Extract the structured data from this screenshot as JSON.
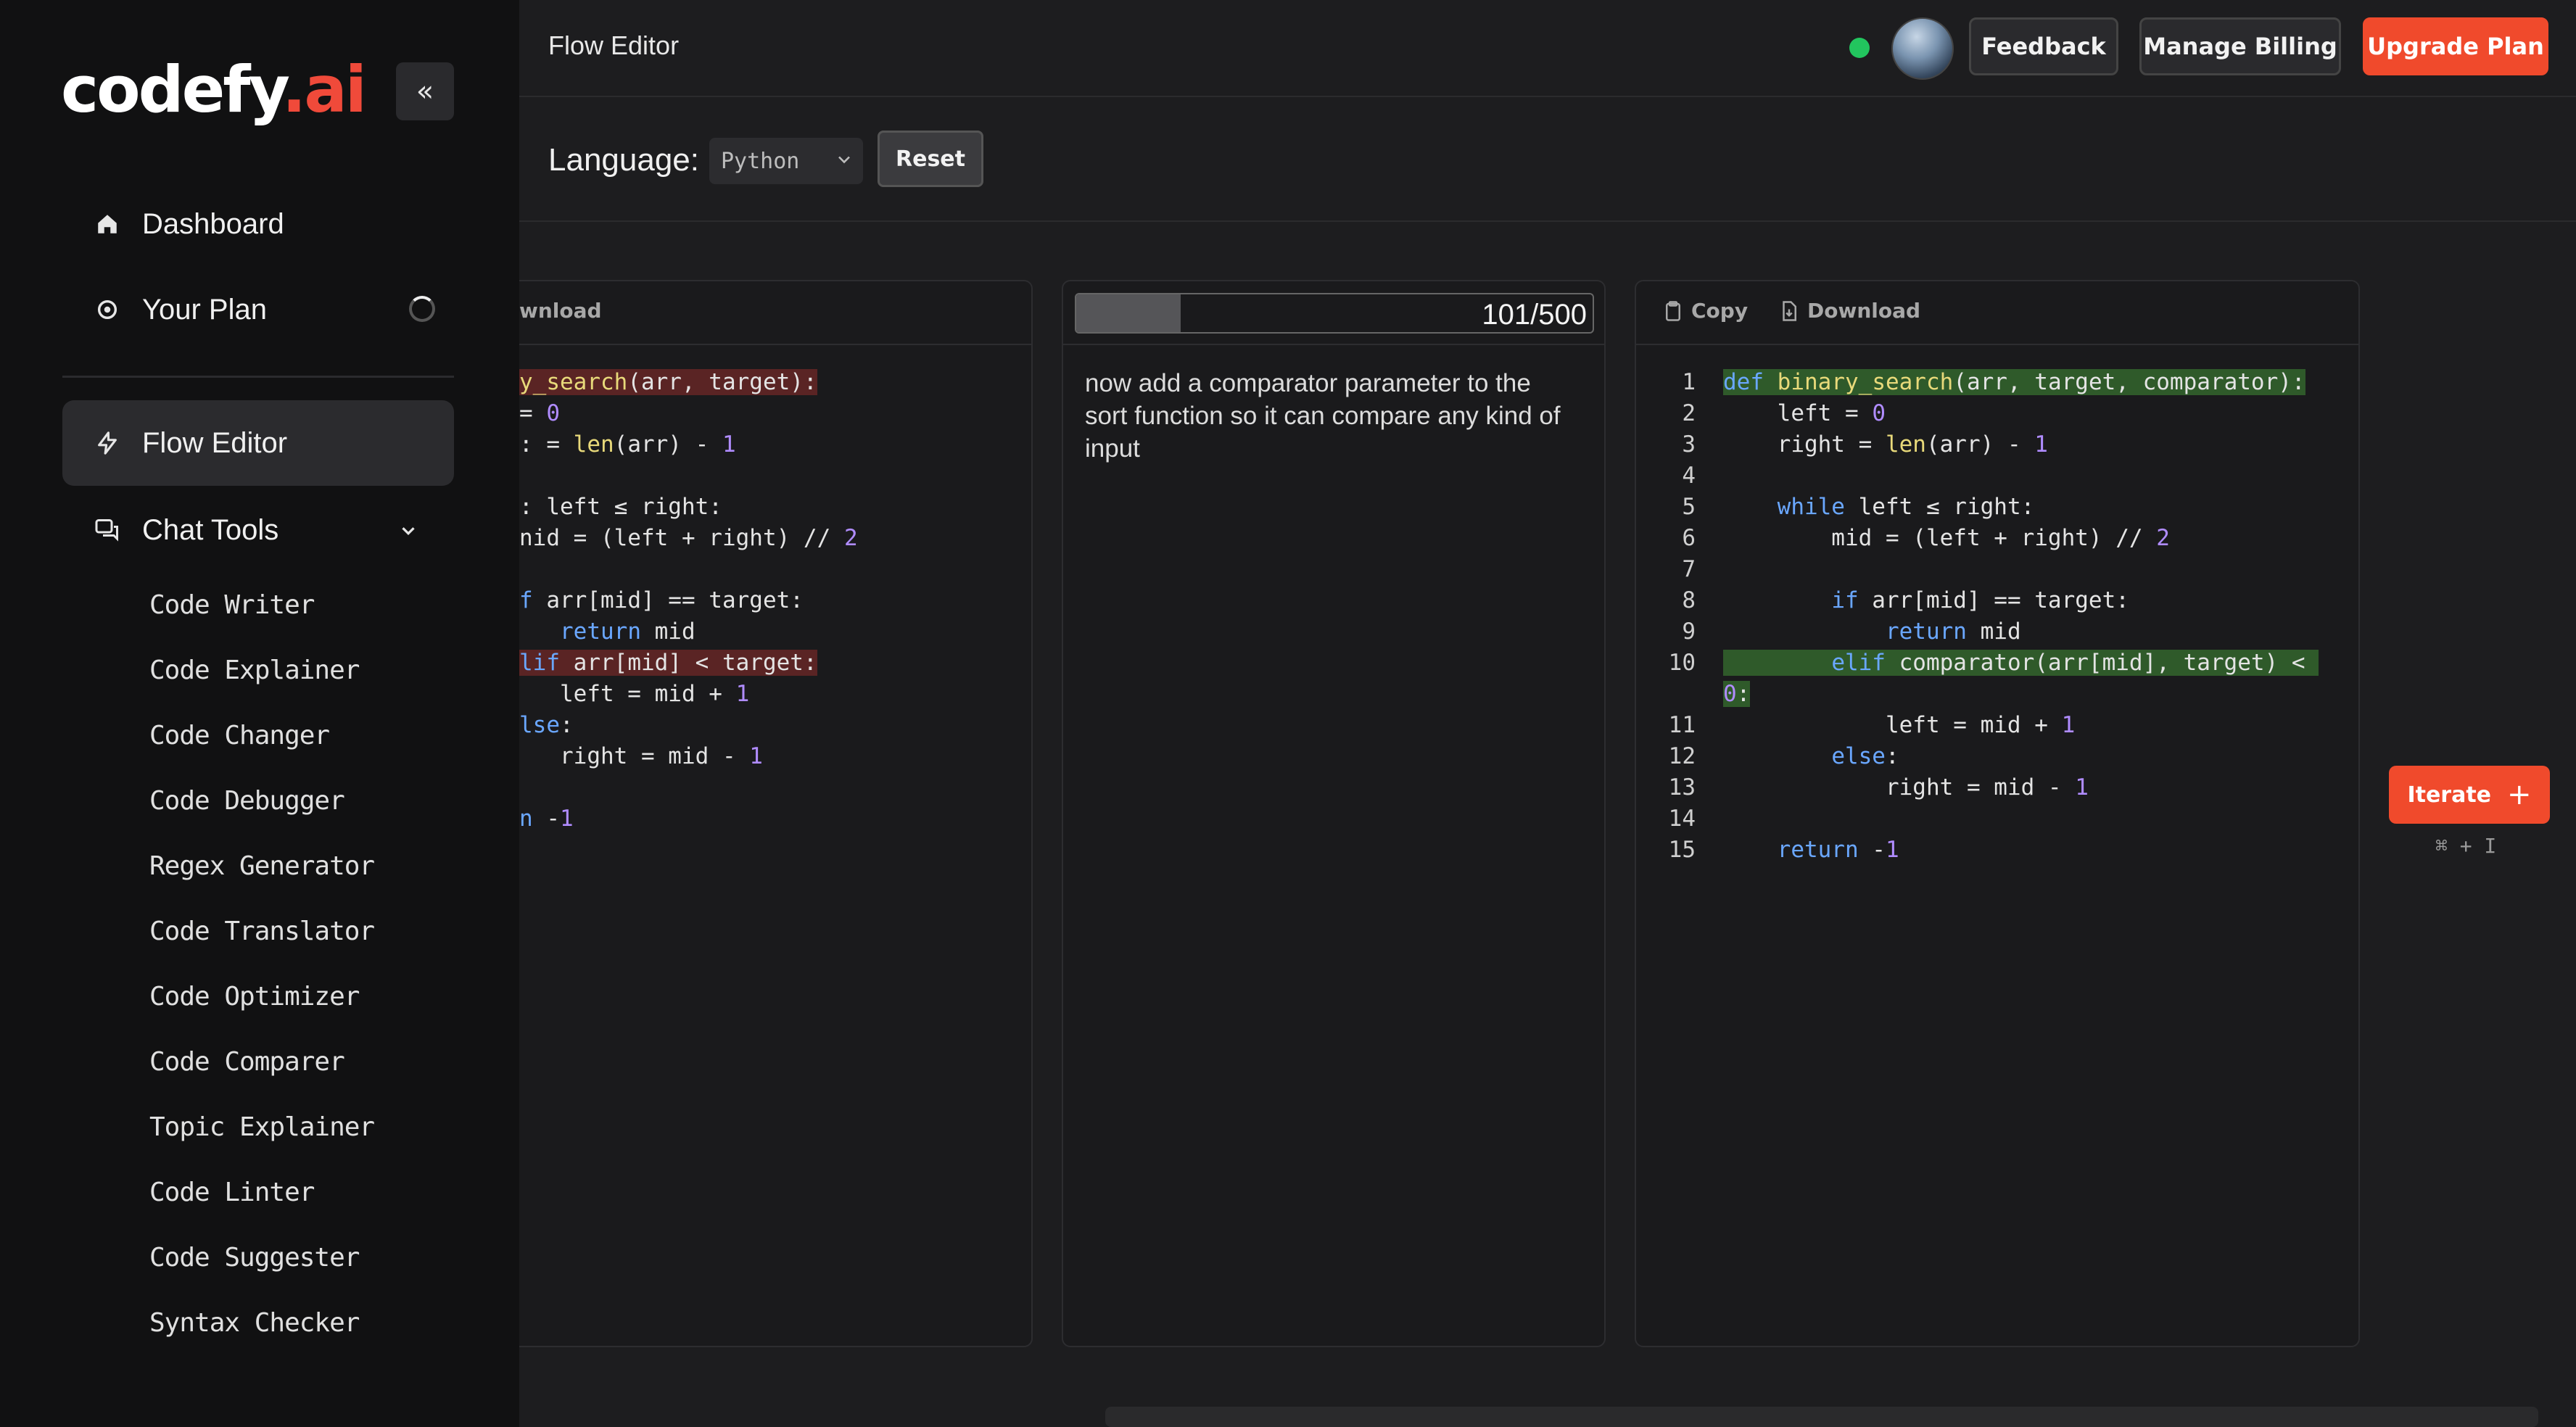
{
  "sidebar": {
    "logo": {
      "word": "codefy",
      "dot": ".",
      "ai": "ai"
    },
    "collapse_icon": "«",
    "items": [
      {
        "label": "Dashboard",
        "icon": "home-icon"
      },
      {
        "label": "Your Plan",
        "icon": "plan-icon"
      },
      {
        "label": "Flow Editor",
        "icon": "lightning-icon"
      },
      {
        "label": "Chat Tools",
        "icon": "chat-icon"
      }
    ],
    "chat_tools": [
      "Code Writer",
      "Code Explainer",
      "Code Changer",
      "Code Debugger",
      "Regex Generator",
      "Code Translator",
      "Code Optimizer",
      "Code Comparer",
      "Topic Explainer",
      "Code Linter",
      "Code Suggester",
      "Syntax Checker"
    ]
  },
  "header": {
    "title": "Flow Editor",
    "feedback_label": "Feedback",
    "billing_label": "Manage Billing",
    "upgrade_label": "Upgrade Plan",
    "status_color": "#22c55e",
    "accent": "#f04a2c"
  },
  "toolbar": {
    "language_label": "Language:",
    "language_value": "Python",
    "reset_label": "Reset"
  },
  "left_panel": {
    "download_label": "wnload",
    "lines": [
      "y_search(arr, target):",
      "= 0",
      ": = len(arr) - 1",
      "",
      ": left ≤ right:",
      "nid = (left + right) // 2",
      "",
      "f arr[mid] == target:",
      "   return mid",
      "lif arr[mid] < target:",
      "   left = mid + 1",
      "lse:",
      "   right = mid - 1",
      "",
      "n -1"
    ]
  },
  "middle_panel": {
    "counter": "101/500",
    "progress": 0.202,
    "prompt": "now add a comparator parameter to the sort function so it can compare any kind of input"
  },
  "right_panel": {
    "copy_label": "Copy",
    "download_label": "Download",
    "line_numbers": [
      "1",
      "2",
      "3",
      "4",
      "5",
      "6",
      "7",
      "8",
      "9",
      "10",
      "11",
      "12",
      "13",
      "14",
      "15"
    ],
    "lines": [
      "def binary_search(arr, target, comparator):",
      "    left = 0",
      "    right = len(arr) - 1",
      "",
      "    while left ≤ right:",
      "        mid = (left + right) // 2",
      "",
      "        if arr[mid] == target:",
      "            return mid",
      "        elif comparator(arr[mid], target) <",
      "0:",
      "            left = mid + 1",
      "        else:",
      "            right = mid - 1",
      "",
      "    return -1"
    ]
  },
  "iterate": {
    "label": "Iterate",
    "plus": "+",
    "shortcut": "⌘ + I"
  }
}
